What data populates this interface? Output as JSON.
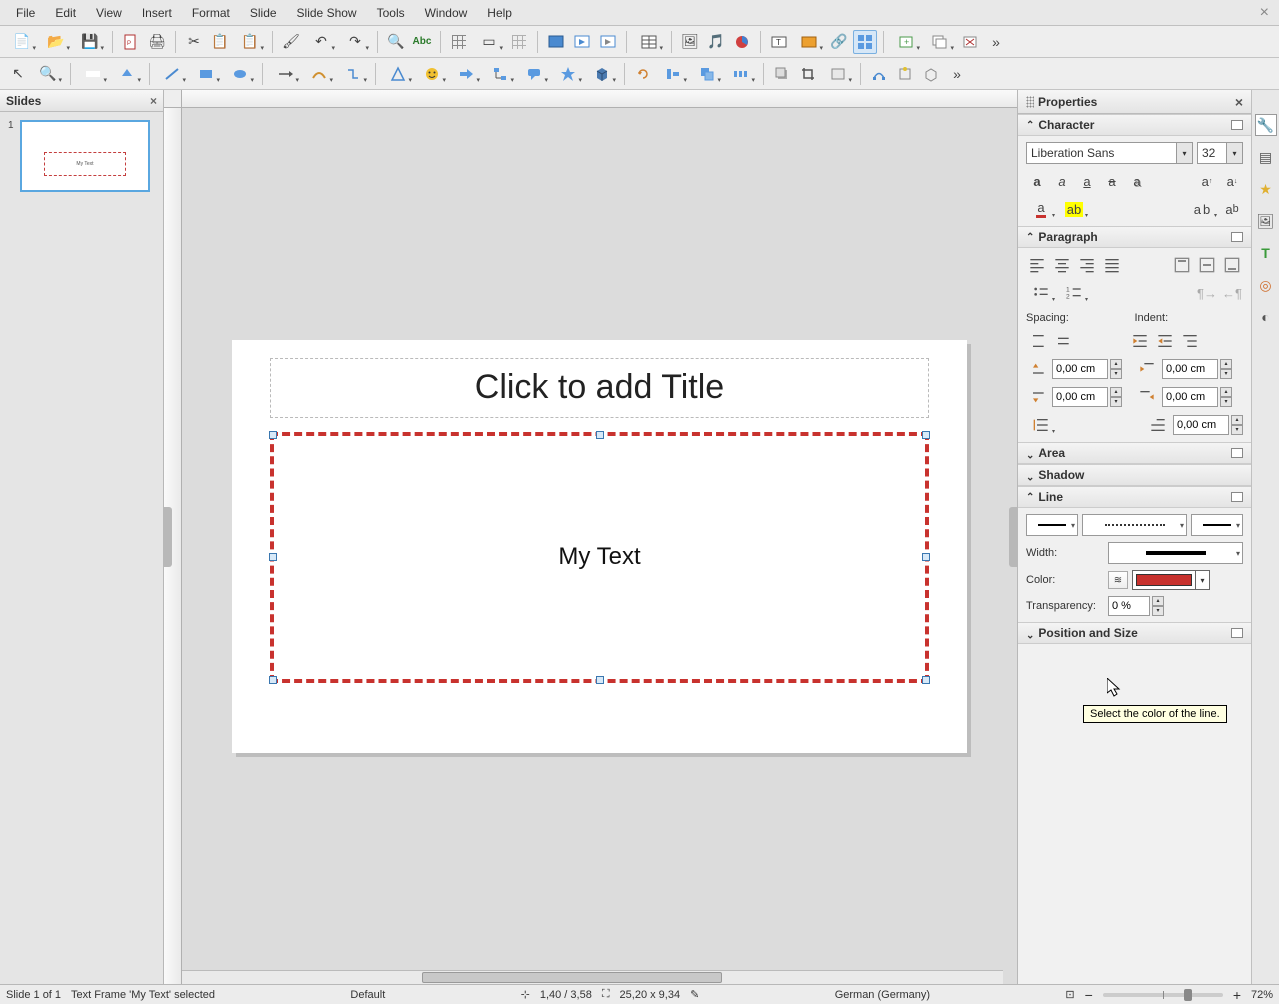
{
  "menu": {
    "items": [
      "File",
      "Edit",
      "View",
      "Insert",
      "Format",
      "Slide",
      "Slide Show",
      "Tools",
      "Window",
      "Help"
    ]
  },
  "slides_panel": {
    "title": "Slides",
    "thumb_num": "1",
    "thumb_text": "My Text"
  },
  "canvas": {
    "title_placeholder": "Click to add Title",
    "content_text": "My Text"
  },
  "properties": {
    "title": "Properties",
    "character": {
      "title": "Character",
      "font_name": "Liberation Sans",
      "font_size": "32"
    },
    "paragraph": {
      "title": "Paragraph",
      "spacing_label": "Spacing:",
      "indent_label": "Indent:",
      "spacing_above": "0,00 cm",
      "spacing_below": "0,00 cm",
      "indent_before": "0,00 cm",
      "indent_after": "0,00 cm",
      "indent_first": "0,00 cm"
    },
    "area": {
      "title": "Area"
    },
    "shadow": {
      "title": "Shadow"
    },
    "line": {
      "title": "Line",
      "width_label": "Width:",
      "color_label": "Color:",
      "transparency_label": "Transparency:",
      "transparency_value": "0 %",
      "color_value": "#c8322e"
    },
    "position": {
      "title": "Position and Size"
    }
  },
  "tooltip": {
    "color_line": "Select the color of the line."
  },
  "status": {
    "slide_info": "Slide 1 of 1",
    "selection": "Text Frame 'My Text' selected",
    "master": "Default",
    "cursor_pos": "1,40 / 3,58",
    "size": "25,20 x 9,34",
    "language": "German (Germany)",
    "zoom": "72%"
  }
}
